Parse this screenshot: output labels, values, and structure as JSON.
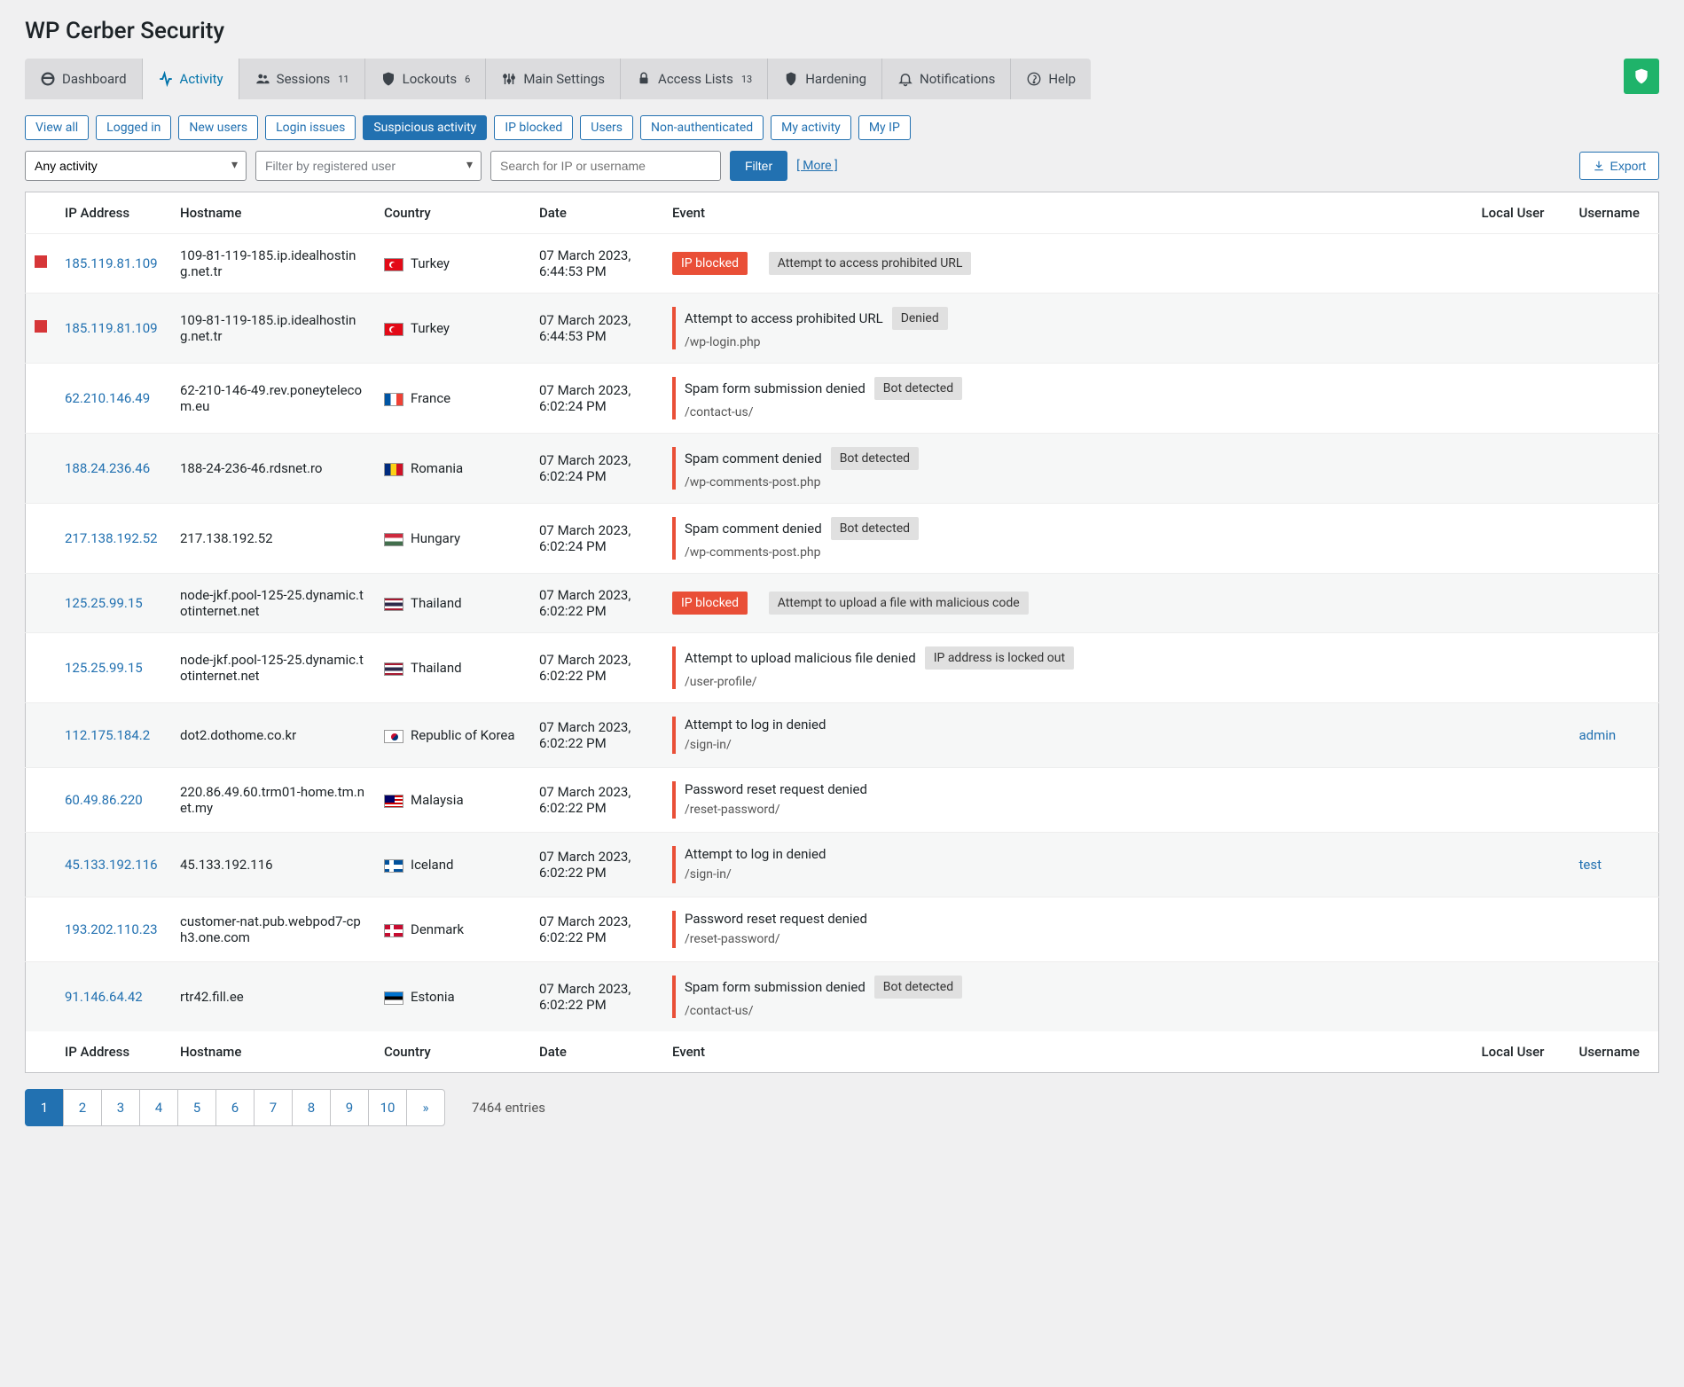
{
  "page_title": "WP Cerber Security",
  "tabs": [
    {
      "key": "dashboard",
      "label": "Dashboard"
    },
    {
      "key": "activity",
      "label": "Activity",
      "active": true
    },
    {
      "key": "sessions",
      "label": "Sessions",
      "badge": "11"
    },
    {
      "key": "lockouts",
      "label": "Lockouts",
      "badge": "6"
    },
    {
      "key": "main",
      "label": "Main Settings"
    },
    {
      "key": "acl",
      "label": "Access Lists",
      "badge": "13"
    },
    {
      "key": "hardening",
      "label": "Hardening"
    },
    {
      "key": "notify",
      "label": "Notifications"
    },
    {
      "key": "help",
      "label": "Help"
    }
  ],
  "filter_links": [
    {
      "label": "View all"
    },
    {
      "label": "Logged in"
    },
    {
      "label": "New users"
    },
    {
      "label": "Login issues"
    },
    {
      "label": "Suspicious activity",
      "active": true
    },
    {
      "label": "IP blocked"
    },
    {
      "label": "Users"
    },
    {
      "label": "Non-authenticated"
    },
    {
      "label": "My activity"
    },
    {
      "label": "My IP"
    }
  ],
  "controls": {
    "activity_select": "Any activity",
    "user_filter_placeholder": "Filter by registered user",
    "search_placeholder": "Search for IP or username",
    "filter_button": "Filter",
    "more_link": "[ More ]",
    "export_button": "Export"
  },
  "columns": {
    "ip": "IP Address",
    "host": "Hostname",
    "country": "Country",
    "date": "Date",
    "event": "Event",
    "local": "Local User",
    "user": "Username"
  },
  "rows": [
    {
      "mark": true,
      "ip": "185.119.81.109",
      "host": "109-81-119-185.ip.idealhosting.net.tr",
      "flag": "tr",
      "country": "Turkey",
      "date": "07 March 2023, 6:44:53 PM",
      "kind": "blocked",
      "event": "IP blocked",
      "reason": "Attempt to access prohibited URL"
    },
    {
      "mark": true,
      "ip": "185.119.81.109",
      "host": "109-81-119-185.ip.idealhosting.net.tr",
      "flag": "tr",
      "country": "Turkey",
      "date": "07 March 2023, 6:44:53 PM",
      "kind": "detail",
      "event": "Attempt to access prohibited URL",
      "tag": "Denied",
      "path": "/wp-login.php"
    },
    {
      "ip": "62.210.146.49",
      "host": "62-210-146-49.rev.poneytelecom.eu",
      "flag": "fr",
      "country": "France",
      "date": "07 March 2023, 6:02:24 PM",
      "kind": "detail",
      "event": "Spam form submission denied",
      "tag": "Bot detected",
      "path": "/contact-us/"
    },
    {
      "ip": "188.24.236.46",
      "host": "188-24-236-46.rdsnet.ro",
      "flag": "ro",
      "country": "Romania",
      "date": "07 March 2023, 6:02:24 PM",
      "kind": "detail",
      "event": "Spam comment denied",
      "tag": "Bot detected",
      "path": "/wp-comments-post.php"
    },
    {
      "ip": "217.138.192.52",
      "host": "217.138.192.52",
      "flag": "hu",
      "country": "Hungary",
      "date": "07 March 2023, 6:02:24 PM",
      "kind": "detail",
      "event": "Spam comment denied",
      "tag": "Bot detected",
      "path": "/wp-comments-post.php"
    },
    {
      "ip": "125.25.99.15",
      "host": "node-jkf.pool-125-25.dynamic.totinternet.net",
      "flag": "th",
      "country": "Thailand",
      "date": "07 March 2023, 6:02:22 PM",
      "kind": "blocked",
      "event": "IP blocked",
      "reason": "Attempt to upload a file with malicious code"
    },
    {
      "ip": "125.25.99.15",
      "host": "node-jkf.pool-125-25.dynamic.totinternet.net",
      "flag": "th",
      "country": "Thailand",
      "date": "07 March 2023, 6:02:22 PM",
      "kind": "detail",
      "event": "Attempt to upload malicious file denied",
      "tag": "IP address is locked out",
      "path": "/user-profile/"
    },
    {
      "ip": "112.175.184.2",
      "host": "dot2.dothome.co.kr",
      "flag": "kr",
      "country": "Republic of Korea",
      "date": "07 March 2023, 6:02:22 PM",
      "kind": "detail",
      "event": "Attempt to log in denied",
      "path": "/sign-in/",
      "username": "admin"
    },
    {
      "ip": "60.49.86.220",
      "host": "220.86.49.60.trm01-home.tm.net.my",
      "flag": "my",
      "country": "Malaysia",
      "date": "07 March 2023, 6:02:22 PM",
      "kind": "detail",
      "event": "Password reset request denied",
      "path": "/reset-password/"
    },
    {
      "ip": "45.133.192.116",
      "host": "45.133.192.116",
      "flag": "is",
      "country": "Iceland",
      "date": "07 March 2023, 6:02:22 PM",
      "kind": "detail",
      "event": "Attempt to log in denied",
      "path": "/sign-in/",
      "username": "test"
    },
    {
      "ip": "193.202.110.23",
      "host": "customer-nat.pub.webpod7-cph3.one.com",
      "flag": "dk",
      "country": "Denmark",
      "date": "07 March 2023, 6:02:22 PM",
      "kind": "detail",
      "event": "Password reset request denied",
      "path": "/reset-password/"
    },
    {
      "ip": "91.146.64.42",
      "host": "rtr42.fill.ee",
      "flag": "ee",
      "country": "Estonia",
      "date": "07 March 2023, 6:02:22 PM",
      "kind": "detail",
      "event": "Spam form submission denied",
      "tag": "Bot detected",
      "path": "/contact-us/"
    }
  ],
  "pagination": {
    "pages": [
      "1",
      "2",
      "3",
      "4",
      "5",
      "6",
      "7",
      "8",
      "9",
      "10",
      "»"
    ],
    "active": "1",
    "entries": "7464 entries"
  }
}
